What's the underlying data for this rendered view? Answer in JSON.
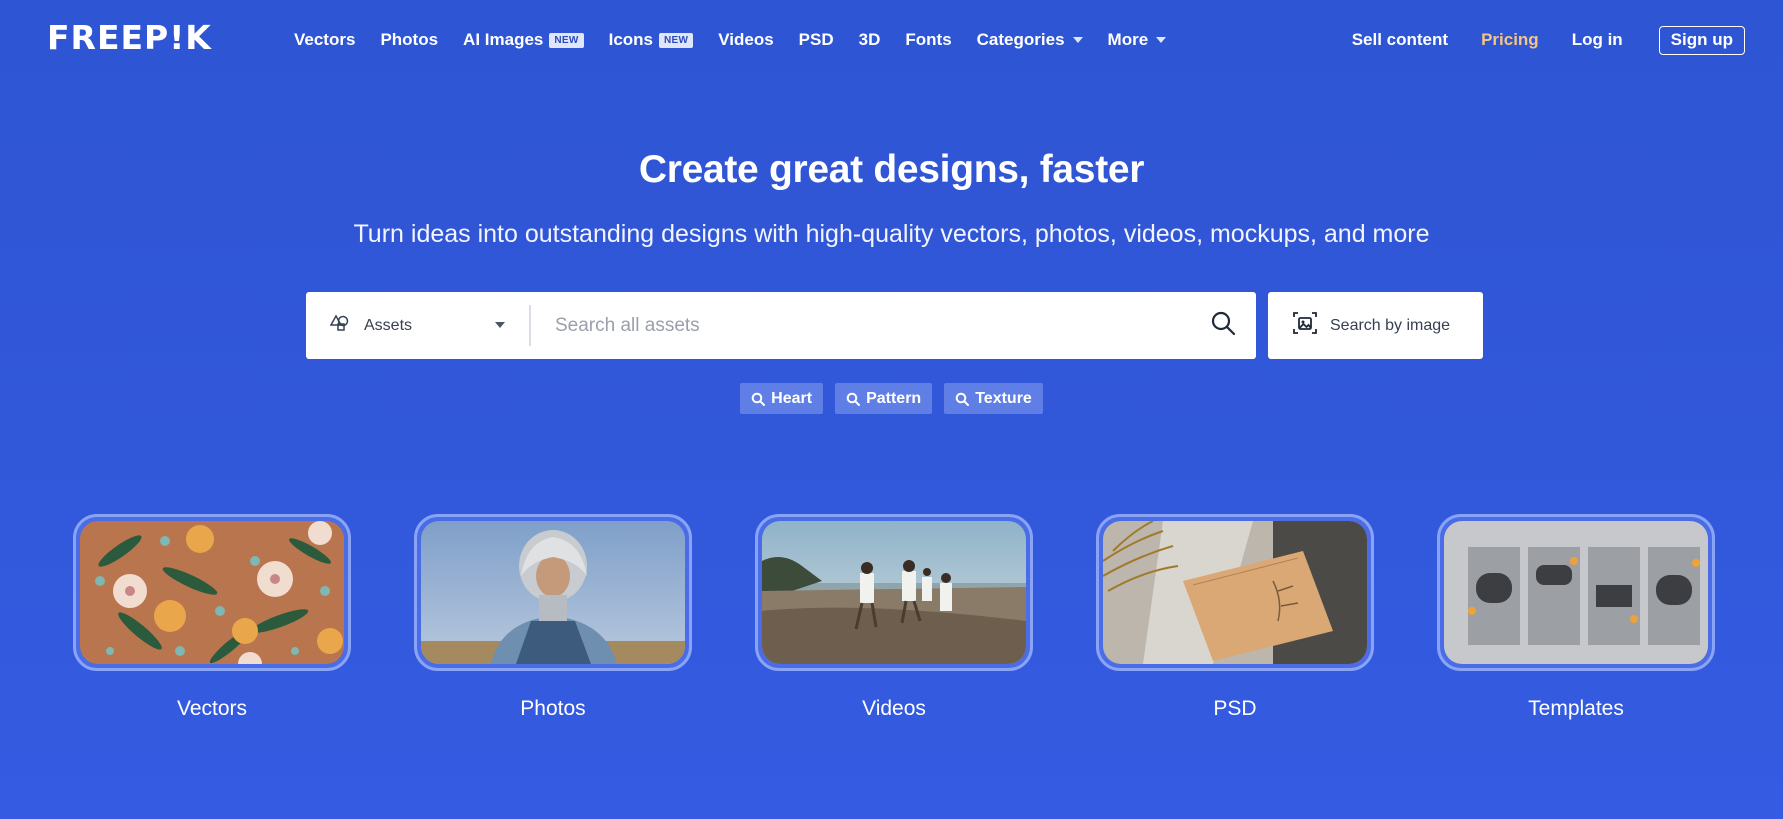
{
  "brand": {
    "logo_text": "FREEP!K"
  },
  "nav": {
    "items": [
      {
        "label": "Vectors"
      },
      {
        "label": "Photos"
      },
      {
        "label": "AI Images",
        "badge": "NEW"
      },
      {
        "label": "Icons",
        "badge": "NEW"
      },
      {
        "label": "Videos"
      },
      {
        "label": "PSD"
      },
      {
        "label": "3D"
      },
      {
        "label": "Fonts"
      },
      {
        "label": "Categories"
      },
      {
        "label": "More"
      }
    ]
  },
  "header_right": {
    "sell": "Sell content",
    "pricing": "Pricing",
    "login": "Log in",
    "signup": "Sign up"
  },
  "hero": {
    "title": "Create great designs, faster",
    "subtitle": "Turn ideas into outstanding designs with high-quality vectors, photos, videos, mockups, and more"
  },
  "search": {
    "asset_type": "Assets",
    "placeholder": "Search all assets",
    "value": "",
    "image_search_label": "Search by image"
  },
  "tags": [
    "Heart",
    "Pattern",
    "Texture"
  ],
  "categories": [
    {
      "label": "Vectors"
    },
    {
      "label": "Photos"
    },
    {
      "label": "Videos"
    },
    {
      "label": "PSD"
    },
    {
      "label": "Templates"
    }
  ],
  "colors": {
    "background": "#2e55d3",
    "pricing": "#f4c484",
    "tag_bg": "#5f7fe6",
    "card_border": "#8aa4f5"
  },
  "icons": {
    "assets": "shapes-icon",
    "search": "search-icon",
    "image_search": "image-search-icon",
    "tag": "search-icon"
  }
}
